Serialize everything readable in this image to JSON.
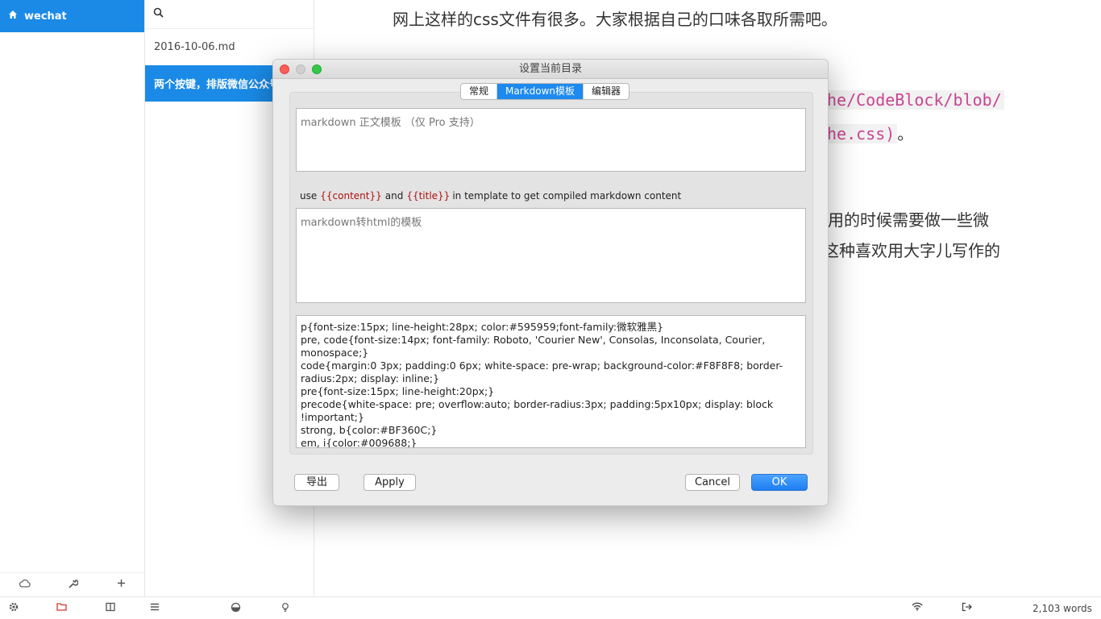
{
  "sidebar": {
    "title": "wechat",
    "icons": [
      "home-icon",
      "cloud-sync-icon",
      "wrench-icon",
      "plus-icon"
    ]
  },
  "filelist": {
    "items": [
      {
        "label": "2016-10-06.md"
      },
      {
        "label": "两个按键，排版微信公众号"
      }
    ]
  },
  "editor": {
    "lines": [
      "网上这样的css文件有很多。大家根据自己的口味各取所需吧。",
      "he/CodeBlock/blob/",
      "he.css)",
      "。",
      "用的时候需要做一些微",
      "这种喜欢用大字儿写作的"
    ]
  },
  "dialog": {
    "title": "设置当前目录",
    "tabs": [
      "常规",
      "Markdown模板",
      "编辑器"
    ],
    "active_tab": "Markdown模板",
    "body_template_placeholder": "markdown 正文模板 （仅 Pro 支持）",
    "hint": {
      "use": "use",
      "content_token": "{{content}}",
      "and": "and",
      "title_token": "{{title}}",
      "rest": "in template to get compiled markdown content"
    },
    "html_template_placeholder": "markdown转html的模板",
    "css_lines": [
      "p{font-size:15px; line-height:28px; color:#595959;font-family:微软雅黑}",
      "pre, code{font-size:14px;  font-family: Roboto, 'Courier New', Consolas, Inconsolata, Courier, monospace;}",
      "code{margin:0 3px;  padding:0 6px;  white-space: pre-wrap;  background-color:#F8F8F8;  border-radius:2px;  display: inline;}",
      "pre{font-size:15px;  line-height:20px;}",
      "precode{white-space: pre; overflow:auto; border-radius:3px; padding:5px10px; display: block !important;}",
      "strong, b{color:#BF360C;}",
      "em, i{color:#009688;}"
    ],
    "buttons": {
      "export": "导出",
      "apply": "Apply",
      "cancel": "Cancel",
      "ok": "OK"
    }
  },
  "statusbar": {
    "word_count": "2,103 words",
    "icons": [
      "settings-icon",
      "folder-icon",
      "split-view-icon",
      "menu-icon",
      "theme-icon",
      "bulb-icon",
      "wifi-icon",
      "export-icon"
    ]
  },
  "colors": {
    "accent": "#1a8ae6",
    "link": "#c84590"
  }
}
